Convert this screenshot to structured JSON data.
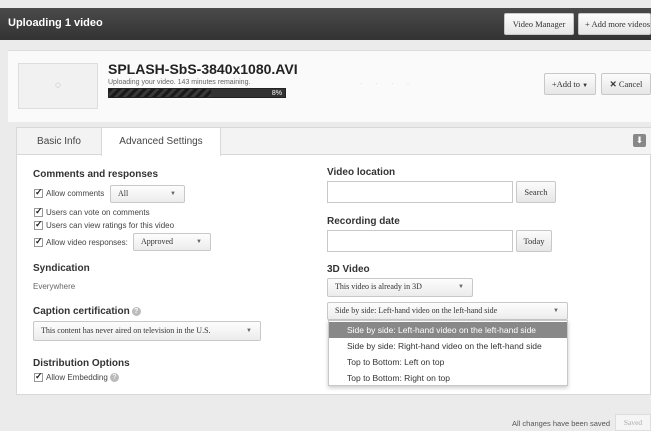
{
  "header": {
    "title": "Uploading 1 video",
    "video_manager_label": "Video Manager",
    "add_more_label": "Add more videos"
  },
  "upload": {
    "filename": "SPLASH-SbS-3840x1080.AVI",
    "status": "Uploading your video. 143 minutes remaining.",
    "progress_percent_label": "8%",
    "progress_fraction": 0.08,
    "add_to_label": "Add to",
    "cancel_label": "Cancel"
  },
  "tabs": [
    {
      "label": "Basic Info"
    },
    {
      "label": "Advanced Settings"
    }
  ],
  "comments": {
    "heading": "Comments and responses",
    "allow_comments_label": "Allow comments",
    "allow_comments_value": "All",
    "vote_label": "Users can vote on comments",
    "ratings_label": "Users can view ratings for this video",
    "video_responses_label": "Allow video responses:",
    "video_responses_value": "Approved"
  },
  "syndication": {
    "heading": "Syndication",
    "value": "Everywhere"
  },
  "caption": {
    "heading": "Caption certification",
    "value": "This content has never aired on television in the U.S."
  },
  "distribution": {
    "heading": "Distribution Options",
    "embedding_label": "Allow Embedding"
  },
  "location": {
    "heading": "Video location",
    "search_label": "Search"
  },
  "recording": {
    "heading": "Recording date",
    "today_label": "Today"
  },
  "video3d": {
    "heading": "3D Video",
    "mode_value": "This video is already in 3D",
    "layout_value": "Side by side: Left-hand video on the left-hand side",
    "options": [
      "Side by side: Left-hand video on the left-hand side",
      "Side by side: Right-hand video on the left-hand side",
      "Top to Bottom: Left on top",
      "Top to Bottom: Right on top"
    ]
  },
  "footer": {
    "status": "All changes have been saved",
    "saved_label": "Saved"
  }
}
